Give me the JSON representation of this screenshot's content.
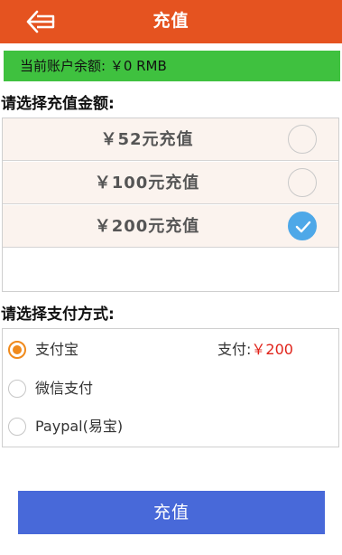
{
  "header": {
    "title": "充值",
    "back_icon": "back-arrow-icon"
  },
  "balance": {
    "text": "当前账户余额: ￥0 RMB"
  },
  "amount_section": {
    "label": "请选择充值金额:",
    "options": [
      {
        "label": "￥52元充值",
        "selected": false
      },
      {
        "label": "￥100元充值",
        "selected": false
      },
      {
        "label": "￥200元充值",
        "selected": true
      }
    ]
  },
  "payment_section": {
    "label": "请选择支付方式:",
    "methods": [
      {
        "label": "支付宝",
        "selected": true
      },
      {
        "label": "微信支付",
        "selected": false
      },
      {
        "label": "Paypal(易宝)",
        "selected": false
      }
    ],
    "total_label": "支付:",
    "total_amount": "￥200"
  },
  "submit_label": "充值",
  "colors": {
    "header": "#e55320",
    "balance_bg": "#3fc13f",
    "check_blue": "#4ea8e8",
    "radio_orange": "#f08a1c",
    "price_red": "#e0231a",
    "submit_blue": "#4869d9"
  }
}
